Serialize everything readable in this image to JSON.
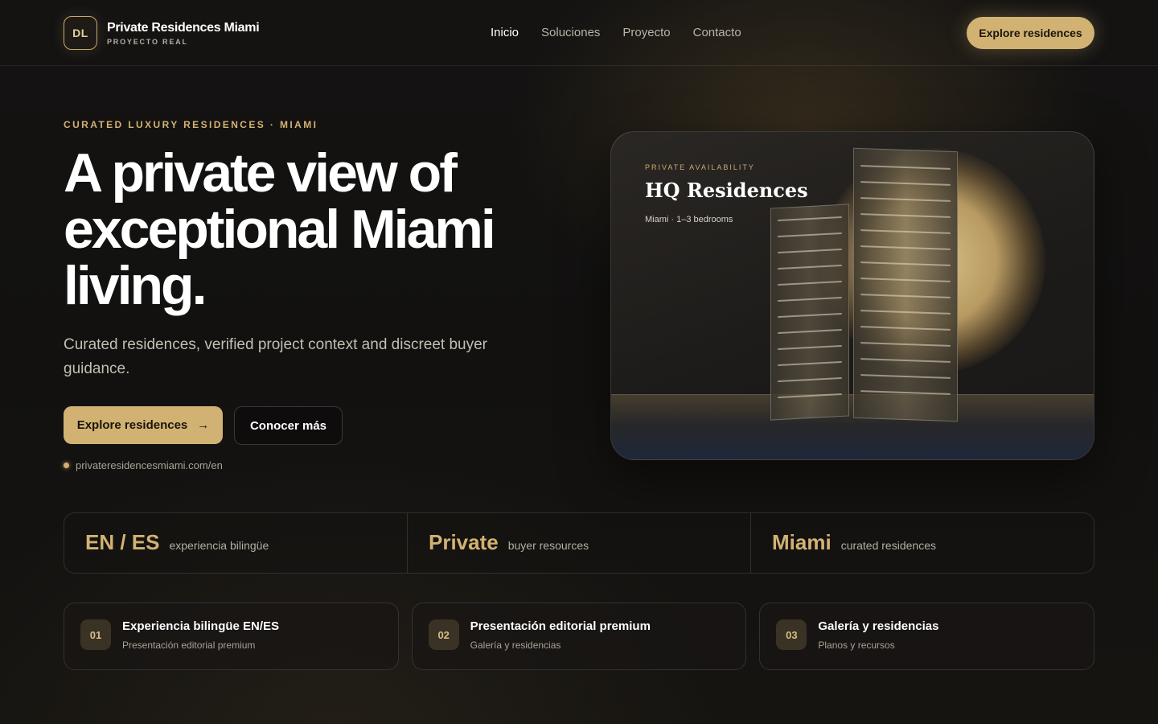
{
  "header": {
    "logo_initials": "DL",
    "brand_name": "Private Residences Miami",
    "brand_sub": "PROYECTO REAL",
    "nav": [
      "Inicio",
      "Soluciones",
      "Proyecto",
      "Contacto"
    ],
    "active_nav": "Inicio",
    "cta": "Explore residences"
  },
  "hero": {
    "eyebrow": "CURATED LUXURY RESIDENCES · MIAMI",
    "title": "A private view of exceptional Miami living.",
    "subtitle": "Curated residences, verified project context and discreet buyer guidance.",
    "primary_cta": "Explore residences",
    "primary_cta_icon": "arrow-right-icon",
    "secondary_cta": "Conocer más",
    "site_url": "privateresidencesmiami.com/en"
  },
  "card": {
    "eyebrow": "PRIVATE AVAILABILITY",
    "title": "HQ Residences",
    "meta": "Miami · 1–3 bedrooms"
  },
  "stats": [
    {
      "value": "EN / ES",
      "label": "experiencia bilingüe"
    },
    {
      "value": "Private",
      "label": "buyer resources"
    },
    {
      "value": "Miami",
      "label": "curated residences"
    }
  ],
  "features": [
    {
      "num": "01",
      "title": "Experiencia bilingüe EN/ES",
      "desc": "Presentación editorial premium"
    },
    {
      "num": "02",
      "title": "Presentación editorial premium",
      "desc": "Galería y residencias"
    },
    {
      "num": "03",
      "title": "Galería y residencias",
      "desc": "Planos y recursos"
    }
  ],
  "colors": {
    "accent": "#d2b273",
    "background": "#121110",
    "text": "#ffffff"
  }
}
